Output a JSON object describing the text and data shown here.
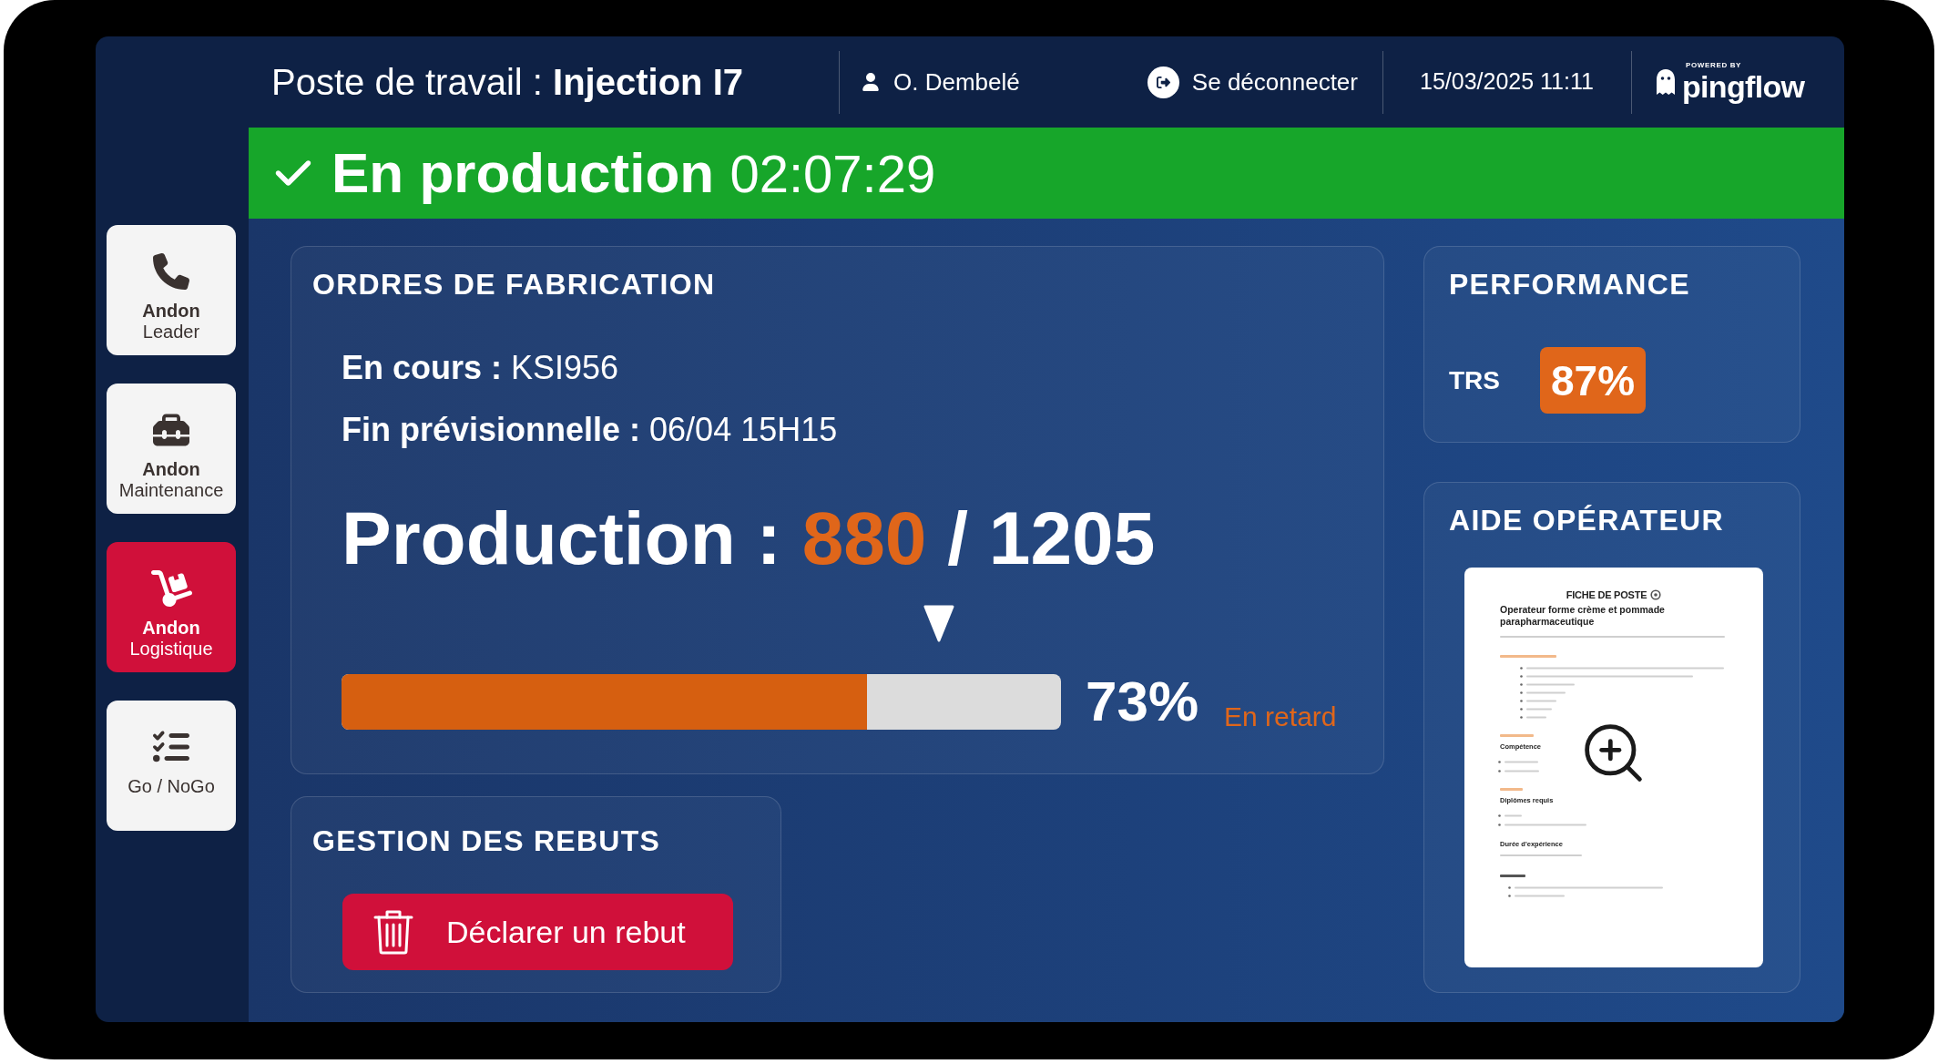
{
  "header": {
    "workstation_label": "Poste de travail :",
    "workstation": "Injection I7",
    "user": "O. Dembelé",
    "logout": "Se déconnecter",
    "datetime": "15/03/2025 11:11",
    "logo": {
      "tagline": "POWERED BY",
      "name": "pingflow"
    }
  },
  "status_banner": {
    "kind": "running",
    "label": "En production",
    "duration": "02:07:29"
  },
  "andon_buttons": [
    {
      "kind": "leader",
      "title": "Andon",
      "label": "Leader",
      "active": false
    },
    {
      "kind": "maintenance",
      "title": "Andon",
      "label": "Maintenance",
      "active": false
    },
    {
      "kind": "logistics",
      "title": "Andon",
      "label": "Logistique",
      "active": true
    },
    {
      "kind": "checklist",
      "label": "Go / NoGo",
      "active": false
    }
  ],
  "orders": {
    "title": "ORDRES DE FABRICATION",
    "fields": [
      {
        "label": "En cours :",
        "value": "KSI956"
      },
      {
        "label": "Fin prévisionnelle :",
        "value": "06/04 15H15"
      }
    ],
    "production": {
      "label": "Production :",
      "done": "880",
      "separator": "/",
      "total": "1205"
    },
    "progress": {
      "level": 0.73,
      "target": {
        "level": 0.83
      },
      "reading": "73%",
      "status": "En retard"
    }
  },
  "scrap": {
    "title": "GESTION DES REBUTS",
    "button": "Déclarer un rebut"
  },
  "performance": {
    "title": "PERFORMANCE",
    "metrics": [
      {
        "label": "TRS",
        "value": "87%"
      }
    ]
  },
  "operator_help": {
    "title": "AIDE OPÉRATEUR",
    "document": {
      "title": "FICHE DE POSTE",
      "heading": "Operateur forme crème et pommade parapharmaceutique",
      "subheadings": [
        "Compétence",
        "Diplômes requis",
        "Durée d'expérience"
      ]
    }
  }
}
